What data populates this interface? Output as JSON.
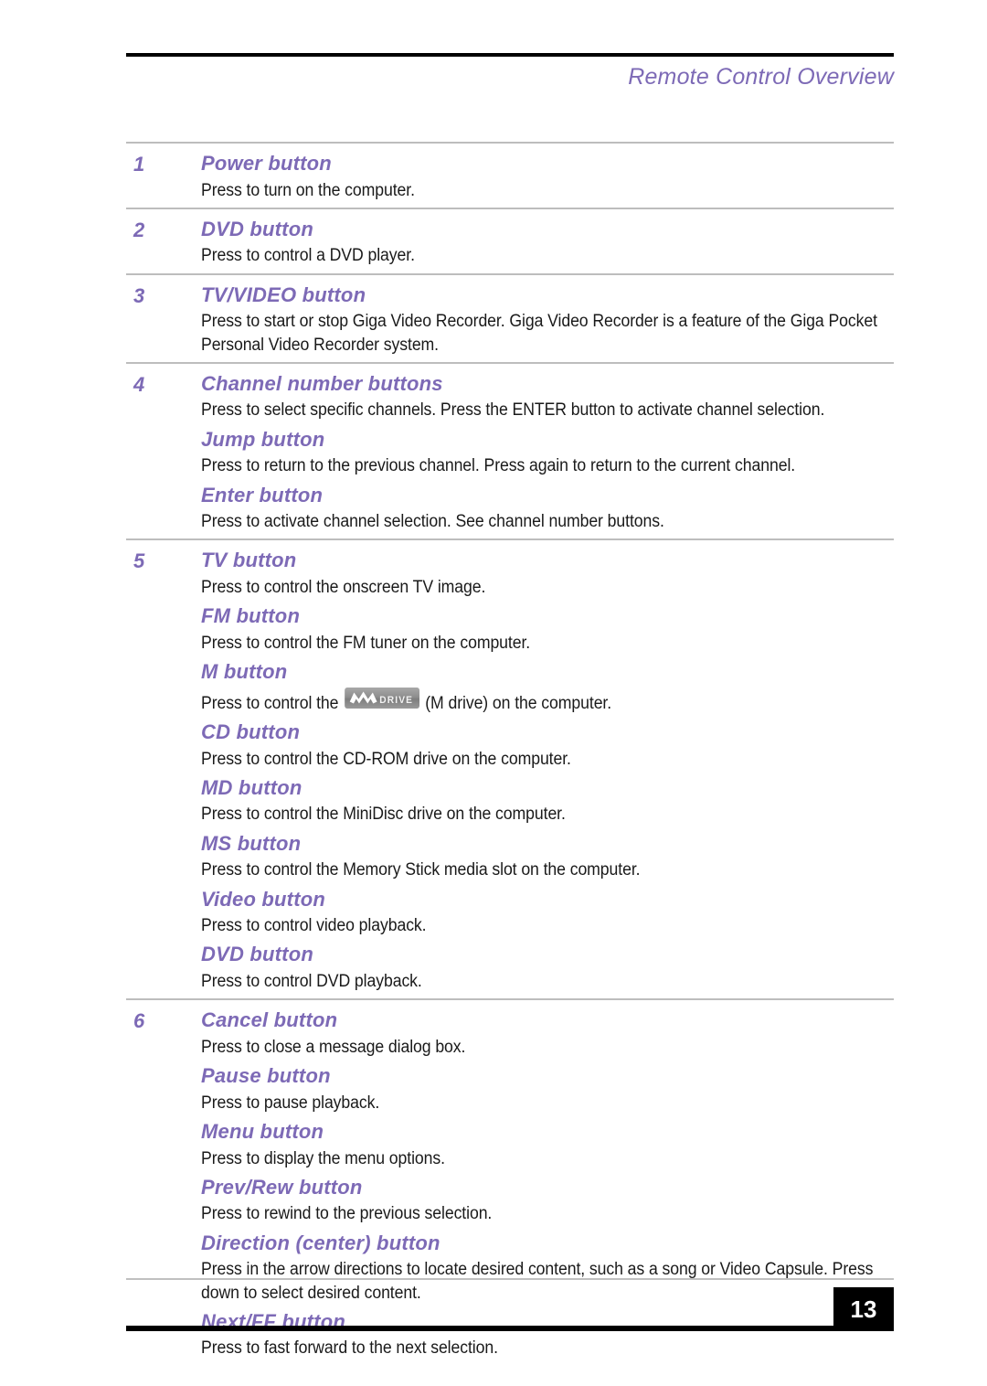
{
  "header": {
    "title": "Remote Control Overview",
    "accent_color": "#7d6ab6"
  },
  "footer": {
    "page_number": "13"
  },
  "logo": {
    "mdrive_label": "DRIVE",
    "mdrive_alt": "M DRIVE"
  },
  "sections": [
    {
      "number": "1",
      "items": [
        {
          "title": "Power button",
          "desc": "Press to turn on the computer."
        }
      ]
    },
    {
      "number": "2",
      "items": [
        {
          "title": "DVD button",
          "desc": "Press to control a DVD player."
        }
      ]
    },
    {
      "number": "3",
      "items": [
        {
          "title": "TV/VIDEO button",
          "desc": "Press to start or stop Giga Video Recorder. Giga Video Recorder is a feature of the Giga Pocket Personal Video Recorder system."
        }
      ]
    },
    {
      "number": "4",
      "items": [
        {
          "title": "Channel number buttons",
          "desc": "Press to select specific channels. Press the ENTER button to activate channel selection."
        },
        {
          "title": "Jump button",
          "desc": "Press to return to the previous channel. Press again to return to the current channel."
        },
        {
          "title": "Enter button",
          "desc": "Press to activate channel selection. See channel number buttons."
        }
      ]
    },
    {
      "number": "5",
      "items": [
        {
          "title": "TV button",
          "desc": "Press to control the onscreen TV image."
        },
        {
          "title": "FM button",
          "desc": "Press to control the FM tuner on the computer."
        },
        {
          "title": "M button",
          "desc_before_logo": "Press to control the",
          "desc_after_logo": "(M drive) on the computer."
        },
        {
          "title": "CD button",
          "desc": "Press to control the CD-ROM drive on the computer."
        },
        {
          "title": "MD button",
          "desc": "Press to control the MiniDisc drive on the computer."
        },
        {
          "title": "MS button",
          "desc": "Press to control the Memory Stick media slot on the computer."
        },
        {
          "title": "Video button",
          "desc": "Press to control video playback."
        },
        {
          "title": "DVD button",
          "desc": "Press to control DVD playback."
        }
      ]
    },
    {
      "number": "6",
      "items": [
        {
          "title": "Cancel button",
          "desc": "Press to close a message dialog box."
        },
        {
          "title": "Pause button",
          "desc": "Press to pause playback."
        },
        {
          "title": "Menu button",
          "desc": "Press to display the menu options."
        },
        {
          "title": "Prev/Rew button",
          "desc": "Press to rewind to the previous selection."
        },
        {
          "title": "Direction (center) button",
          "desc": "Press in the arrow directions to locate desired content, such as a song or Video Capsule. Press down to select desired content."
        },
        {
          "title": "Next/FF button",
          "desc": "Press to fast forward to the next selection."
        }
      ]
    }
  ]
}
